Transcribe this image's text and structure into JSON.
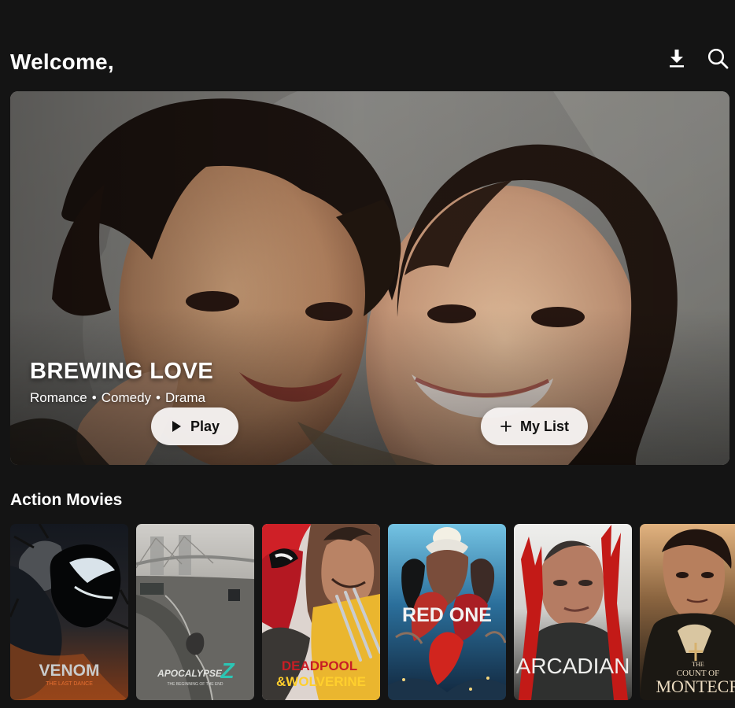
{
  "header": {
    "welcome": "Welcome,",
    "download_icon": "download-icon",
    "search_icon": "search-icon"
  },
  "hero": {
    "title": "BREWING LOVE",
    "genres": [
      "Romance",
      "Comedy",
      "Drama"
    ],
    "separator": "•",
    "play_label": "Play",
    "play_icon": "play-icon",
    "mylist_label": "My List",
    "mylist_icon": "plus-icon"
  },
  "section": {
    "title": "Action Movies"
  },
  "movies": [
    {
      "title_line_1": "VENOM",
      "title_line_2": "THE LAST DANCE",
      "colors": {
        "top": "#14181f",
        "bottom": "#7b3818",
        "accent": "#dd6b24",
        "text": "#c9cccd"
      }
    },
    {
      "title_line_1": "APOCALYPSE",
      "title_line_2": "Z",
      "title_line_3": "THE BEGINNING OF THE END",
      "colors": {
        "top": "#c9c7c2",
        "bottom": "#585754",
        "accent": "#2cc5b4",
        "text": "#e1e2df"
      }
    },
    {
      "title_line_1": "DEADPOOL",
      "title_line_2": "&WOLVERINE",
      "colors": {
        "top": "#dc1e22",
        "bottom": "#c42024",
        "accent": "#f0c22a",
        "text": "#ffcf2d"
      }
    },
    {
      "title_line_1": "RED ONE",
      "colors": {
        "top": "#67b7d8",
        "bottom": "#143047",
        "accent": "#d8251f",
        "text": "#f2f2f2"
      }
    },
    {
      "title_line_1": "ARCADIAN",
      "colors": {
        "top": "#eeeeec",
        "bottom": "#383735",
        "accent": "#c31a17",
        "text": "#efefed"
      }
    },
    {
      "title_line_1": "THE",
      "title_line_2": "COUNT OF",
      "title_line_3": "MONTECRIS",
      "colors": {
        "top": "#d9a56c",
        "bottom": "#191410",
        "accent": "#6c4b24",
        "text": "#ecdcc1"
      }
    }
  ]
}
